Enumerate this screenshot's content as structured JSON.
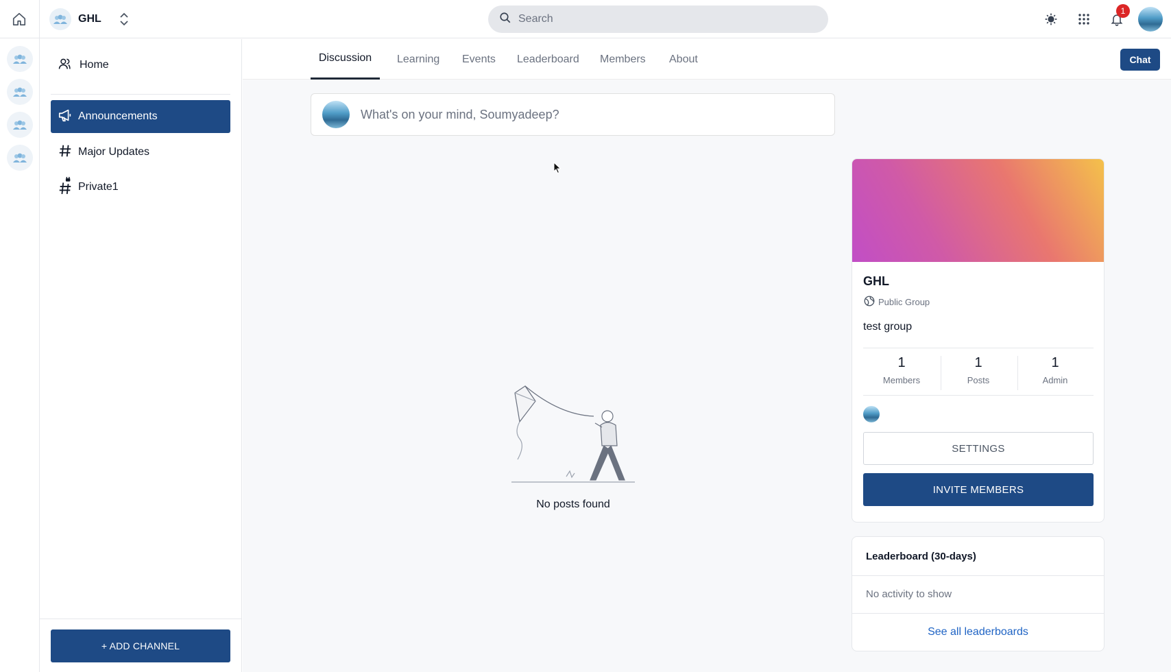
{
  "topbar": {
    "group_name": "GHL",
    "search_placeholder": "Search",
    "notification_count": "1"
  },
  "sidebar": {
    "home_label": "Home",
    "channels": [
      {
        "label": "Announcements",
        "icon": "megaphone-icon",
        "active": true
      },
      {
        "label": "Major Updates",
        "icon": "hash-icon",
        "active": false
      },
      {
        "label": "Private1",
        "icon": "private-hash-icon",
        "active": false
      }
    ],
    "add_channel_label": "+ ADD CHANNEL"
  },
  "tabs": [
    {
      "label": "Discussion",
      "active": true
    },
    {
      "label": "Learning",
      "active": false
    },
    {
      "label": "Events",
      "active": false
    },
    {
      "label": "Leaderboard",
      "active": false
    },
    {
      "label": "Members",
      "active": false
    },
    {
      "label": "About",
      "active": false
    }
  ],
  "chat_label": "Chat",
  "composer": {
    "placeholder": "What's on your mind, Soumyadeep?"
  },
  "empty_state": {
    "text": "No posts found"
  },
  "group_card": {
    "title": "GHL",
    "type": "Public Group",
    "description": "test group",
    "stats": [
      {
        "value": "1",
        "label": "Members"
      },
      {
        "value": "1",
        "label": "Posts"
      },
      {
        "value": "1",
        "label": "Admin"
      }
    ],
    "settings_label": "SETTINGS",
    "invite_label": "INVITE MEMBERS"
  },
  "leaderboard": {
    "title": "Leaderboard (30-days)",
    "empty_text": "No activity to show",
    "link_label": "See all leaderboards"
  },
  "colors": {
    "primary": "#1e4a85",
    "link": "#1e63c4",
    "badge": "#dc2626"
  }
}
